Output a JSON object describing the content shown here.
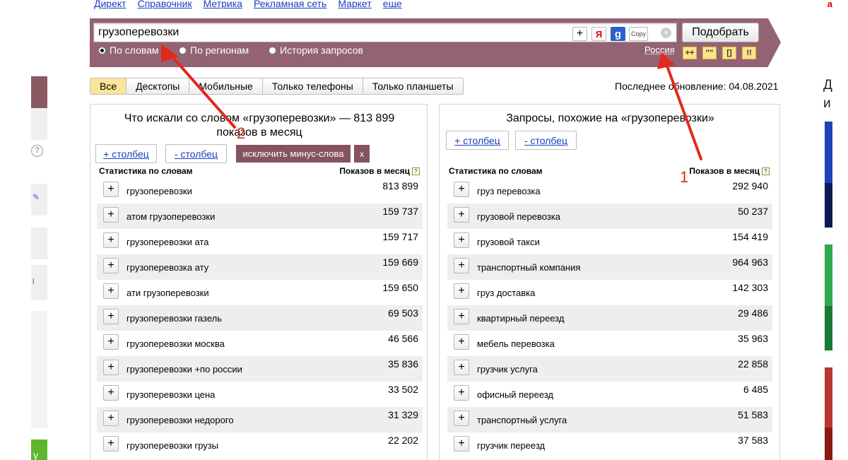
{
  "nav": [
    "Директ",
    "Справочник",
    "Метрика",
    "Рекламная сеть",
    "Маркет",
    "еще"
  ],
  "corner_mark": "a",
  "search": {
    "value": "грузоперевозки",
    "plus_label": "+",
    "yandex_label": "Я",
    "google_label": "g",
    "copy_label": "Copy",
    "clear_label": "×",
    "submit_label": "Подобрать"
  },
  "modes": [
    {
      "label": "По словам",
      "selected": true
    },
    {
      "label": "По регионам",
      "selected": false
    },
    {
      "label": "История запросов",
      "selected": false
    }
  ],
  "region": "Россия",
  "operators": [
    "++",
    "\"\"",
    "[]",
    "!!"
  ],
  "device_tabs": [
    {
      "label": "Все",
      "active": true
    },
    {
      "label": "Десктопы",
      "active": false
    },
    {
      "label": "Мобильные",
      "active": false
    },
    {
      "label": "Только телефоны",
      "active": false
    },
    {
      "label": "Только планшеты",
      "active": false
    }
  ],
  "last_update": "Последнее обновление: 04.08.2021",
  "left_strip": {
    "help_label": "?",
    "pen_label": "✎",
    "mark_label": "l",
    "green_label": "у"
  },
  "right_strip": {
    "letter_1": "Д",
    "letter_2": "и"
  },
  "colors": {
    "band": "#936373",
    "accent_dark": "#85545f",
    "tab_active": "#fbe39a",
    "annotation": "#e02a1e"
  },
  "left_panel": {
    "title_line1": "Что искали со словом «грузоперевозки» — 813 899",
    "title_line2": "показов в месяц",
    "add_col_label": "+ столбец",
    "remove_col_label": "- столбец",
    "minus_words_label": "исключить минус-слова",
    "close_label": "x",
    "col_phrase": "Статистика по словам",
    "col_count": "Показов в месяц",
    "help_label": "?",
    "rows": [
      {
        "phrase": "грузоперевозки",
        "count": "813 899"
      },
      {
        "phrase": "атом грузоперевозки",
        "count": "159 737"
      },
      {
        "phrase": "грузоперевозки ата",
        "count": "159 717"
      },
      {
        "phrase": "грузоперевозка ату",
        "count": "159 669"
      },
      {
        "phrase": "ати грузоперевозки",
        "count": "159 650"
      },
      {
        "phrase": "грузоперевозки газель",
        "count": "69 503"
      },
      {
        "phrase": "грузоперевозки москва",
        "count": "46 566"
      },
      {
        "phrase": "грузоперевозки +по россии",
        "count": "35 836"
      },
      {
        "phrase": "грузоперевозки цена",
        "count": "33 502"
      },
      {
        "phrase": "грузоперевозки недорого",
        "count": "31 329"
      },
      {
        "phrase": "грузоперевозки грузы",
        "count": "22 202"
      }
    ]
  },
  "right_panel": {
    "title": "Запросы, похожие на «грузоперевозки»",
    "add_col_label": "+ столбец",
    "remove_col_label": "- столбец",
    "col_phrase": "Статистика по словам",
    "col_count": "Показов в месяц",
    "help_label": "?",
    "rows": [
      {
        "phrase": "груз перевозка",
        "count": "292 940"
      },
      {
        "phrase": "грузовой перевозка",
        "count": "50 237"
      },
      {
        "phrase": "грузовой такси",
        "count": "154 419"
      },
      {
        "phrase": "транспортный компания",
        "count": "964 963"
      },
      {
        "phrase": "груз доставка",
        "count": "142 303"
      },
      {
        "phrase": "квартирный переезд",
        "count": "29 486"
      },
      {
        "phrase": "мебель перевозка",
        "count": "35 963"
      },
      {
        "phrase": "грузчик услуга",
        "count": "22 858"
      },
      {
        "phrase": "офисный переезд",
        "count": "6 485"
      },
      {
        "phrase": "транспортный услуга",
        "count": "51 583"
      },
      {
        "phrase": "грузчик переезд",
        "count": "37 583"
      }
    ]
  },
  "annotations": {
    "num_1": "1",
    "num_2": "2"
  }
}
